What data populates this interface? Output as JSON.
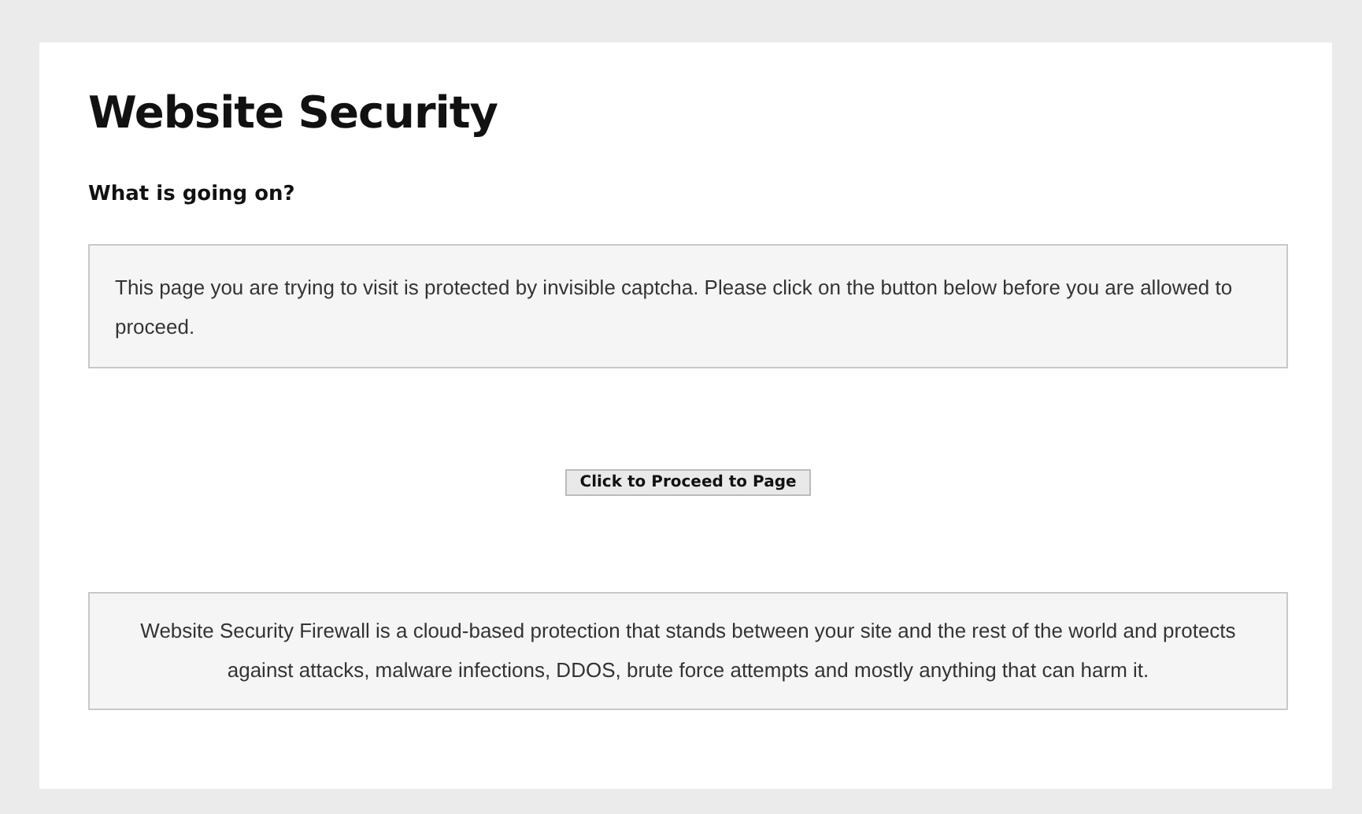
{
  "title": "Website Security",
  "subtitle": "What is going on?",
  "notice": "This page you are trying to visit is protected by invisible captcha. Please click on the button below before you are allowed to proceed.",
  "button": "Click to Proceed to Page",
  "footer": "Website Security Firewall is a cloud-based protection that stands between your site and the rest of the world and protects against attacks, malware infections, DDOS, brute force attempts and mostly anything that can harm it."
}
